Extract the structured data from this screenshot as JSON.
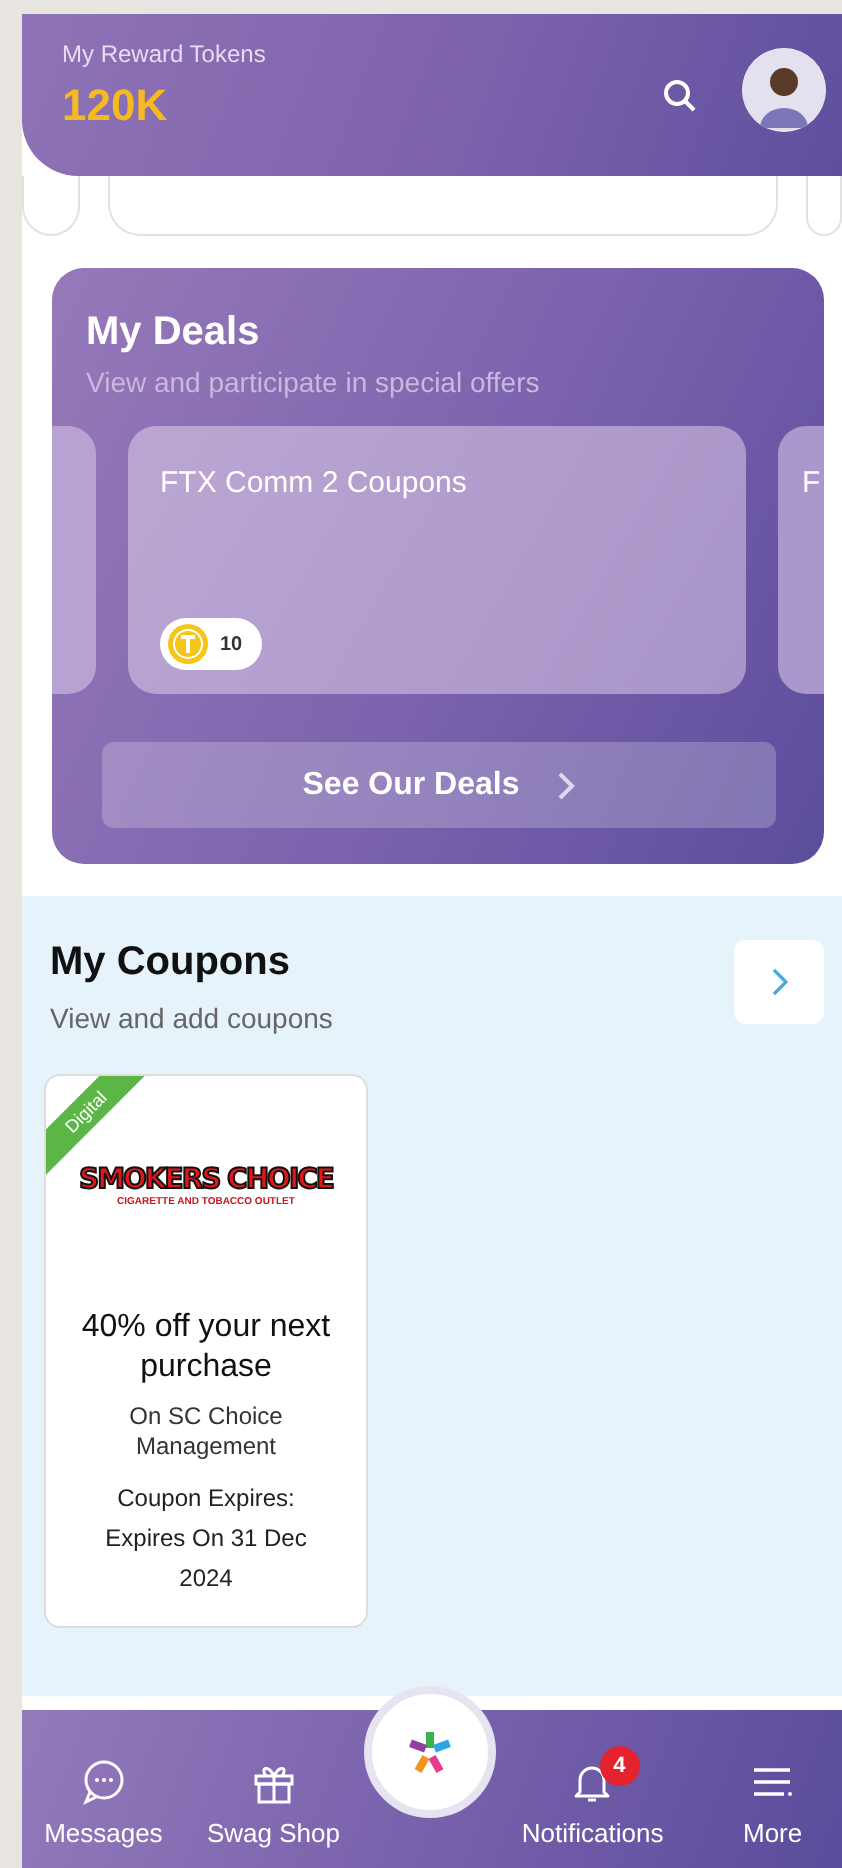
{
  "header": {
    "label": "My Reward Tokens",
    "value": "120K"
  },
  "deals": {
    "title": "My Deals",
    "subtitle": "View and participate in special offers",
    "cards": [
      {
        "title": "FTX Comm 2 Coupons",
        "tokens": "10"
      },
      {
        "title": "F"
      }
    ],
    "button": "See Our Deals"
  },
  "coupons": {
    "title": "My Coupons",
    "subtitle": "View and add coupons",
    "items": [
      {
        "badge": "Digital",
        "brand": "SMOKERS CHOICE",
        "brand_tagline": "CIGARETTE AND TOBACCO OUTLET",
        "offer": "40% off your next purchase",
        "merchant": "On SC Choice Management",
        "expires_label": "Coupon Expires:",
        "expires": "Expires On 31 Dec 2024"
      }
    ]
  },
  "nav": {
    "items": [
      {
        "kind": "chat",
        "label": "Messages"
      },
      {
        "kind": "gift",
        "label": "Swag Shop"
      },
      {
        "kind": "bell",
        "label": "Notifications",
        "badge": "4"
      },
      {
        "kind": "menu",
        "label": "More"
      }
    ]
  }
}
